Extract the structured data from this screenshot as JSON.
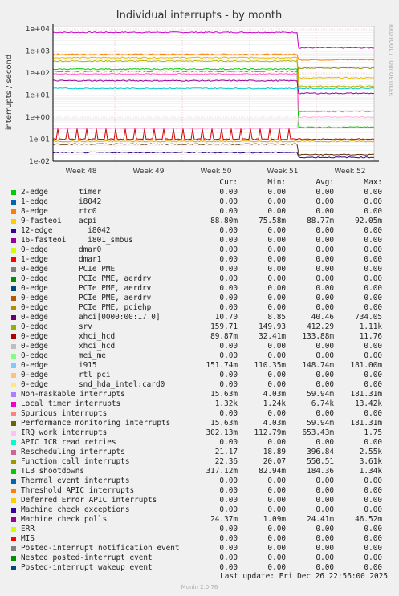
{
  "chart_data": {
    "type": "line",
    "title": "Individual interrupts - by month",
    "ylabel": "interrupts / second",
    "side_label": "RRDTOOL / TOBI OETIKER",
    "y_scale": "log",
    "ylim": [
      0.01,
      10000
    ],
    "y_ticks": [
      "1e-02",
      "1e-01",
      "1e+00",
      "1e+01",
      "1e+02",
      "1e+03",
      "1e+04"
    ],
    "x_ticks": [
      "Week 48",
      "Week 49",
      "Week 50",
      "Week 51",
      "Week 52"
    ],
    "grid": true,
    "series_approx": [
      {
        "color": "#cc00cc",
        "before": 7000,
        "after": 1400
      },
      {
        "color": "#ff8000",
        "before": 700,
        "after": 400
      },
      {
        "color": "#e6b800",
        "before": 500,
        "after": 60
      },
      {
        "color": "#b3b300",
        "before": 350,
        "after": 25
      },
      {
        "color": "#00cc00",
        "before": 150,
        "after": 0.35
      },
      {
        "color": "#888800",
        "before": 120,
        "after": 170
      },
      {
        "color": "#ff66cc",
        "before": 90,
        "after": 1.8
      },
      {
        "color": "#990099",
        "before": 45,
        "after": 12
      },
      {
        "color": "#00cccc",
        "before": 20,
        "after": 20
      },
      {
        "color": "#ffb3e6",
        "before": 0.3,
        "after": 1.0
      },
      {
        "color": "#cc0000",
        "before": 0.1,
        "after": 0.1
      },
      {
        "color": "#e6a800",
        "before": 0.08,
        "after": 0.08
      },
      {
        "color": "#5c2e00",
        "before": 0.06,
        "after": 0.02
      },
      {
        "color": "#2a0080",
        "before": 0.025,
        "after": 0.015
      }
    ]
  },
  "legend": {
    "headers": {
      "cur": "Cur:",
      "min": "Min:",
      "avg": "Avg:",
      "max": "Max:"
    },
    "rows": [
      {
        "color": "#00cc00",
        "name": "2-edge",
        "dev": "timer",
        "cur": "0.00",
        "min": "0.00",
        "avg": "0.00",
        "max": "0.00"
      },
      {
        "color": "#0066b3",
        "name": "1-edge",
        "dev": "i8042",
        "cur": "0.00",
        "min": "0.00",
        "avg": "0.00",
        "max": "0.00"
      },
      {
        "color": "#ff8000",
        "name": "8-edge",
        "dev": "rtc0",
        "cur": "0.00",
        "min": "0.00",
        "avg": "0.00",
        "max": "0.00"
      },
      {
        "color": "#ffcc00",
        "name": "9-fasteoi",
        "dev": "acpi",
        "cur": "88.80m",
        "min": "75.58m",
        "avg": "88.77m",
        "max": "92.05m"
      },
      {
        "color": "#330099",
        "name": "12-edge",
        "dev": "  i8042",
        "cur": "0.00",
        "min": "0.00",
        "avg": "0.00",
        "max": "0.00"
      },
      {
        "color": "#990099",
        "name": "16-fasteoi",
        "dev": "  i801_smbus",
        "cur": "0.00",
        "min": "0.00",
        "avg": "0.00",
        "max": "0.00"
      },
      {
        "color": "#ccff00",
        "name": "0-edge",
        "dev": "dmar0",
        "cur": "0.00",
        "min": "0.00",
        "avg": "0.00",
        "max": "0.00"
      },
      {
        "color": "#ff0000",
        "name": "1-edge",
        "dev": "dmar1",
        "cur": "0.00",
        "min": "0.00",
        "avg": "0.00",
        "max": "0.00"
      },
      {
        "color": "#808080",
        "name": "0-edge",
        "dev": "PCIe PME",
        "cur": "0.00",
        "min": "0.00",
        "avg": "0.00",
        "max": "0.00"
      },
      {
        "color": "#008f00",
        "name": "0-edge",
        "dev": "PCIe PME, aerdrv",
        "cur": "0.00",
        "min": "0.00",
        "avg": "0.00",
        "max": "0.00"
      },
      {
        "color": "#00487d",
        "name": "0-edge",
        "dev": "PCIe PME, aerdrv",
        "cur": "0.00",
        "min": "0.00",
        "avg": "0.00",
        "max": "0.00"
      },
      {
        "color": "#b35a00",
        "name": "0-edge",
        "dev": "PCIe PME, aerdrv",
        "cur": "0.00",
        "min": "0.00",
        "avg": "0.00",
        "max": "0.00"
      },
      {
        "color": "#b38f00",
        "name": "0-edge",
        "dev": "PCIe PME, pciehp",
        "cur": "0.00",
        "min": "0.00",
        "avg": "0.00",
        "max": "0.00"
      },
      {
        "color": "#6b006b",
        "name": "0-edge",
        "dev": "ahci[0000:00:17.0]",
        "cur": "10.70",
        "min": "8.85",
        "avg": "40.46",
        "max": "734.05"
      },
      {
        "color": "#8fb300",
        "name": "0-edge",
        "dev": "srv",
        "cur": "159.71",
        "min": "149.93",
        "avg": "412.29",
        "max": "1.11k"
      },
      {
        "color": "#b30000",
        "name": "0-edge",
        "dev": "xhci_hcd",
        "cur": "89.87m",
        "min": "32.41m",
        "avg": "133.88m",
        "max": "11.76"
      },
      {
        "color": "#bebebe",
        "name": "0-edge",
        "dev": "xhci_hcd",
        "cur": "0.00",
        "min": "0.00",
        "avg": "0.00",
        "max": "0.00"
      },
      {
        "color": "#80ff80",
        "name": "0-edge",
        "dev": "mei_me",
        "cur": "0.00",
        "min": "0.00",
        "avg": "0.00",
        "max": "0.00"
      },
      {
        "color": "#80c9ff",
        "name": "0-edge",
        "dev": "i915",
        "cur": "151.74m",
        "min": "110.35m",
        "avg": "148.74m",
        "max": "181.00m"
      },
      {
        "color": "#ffc080",
        "name": "0-edge",
        "dev": "rtl_pci",
        "cur": "0.00",
        "min": "0.00",
        "avg": "0.00",
        "max": "0.00"
      },
      {
        "color": "#ffe680",
        "name": "0-edge",
        "dev": "snd_hda_intel:card0",
        "cur": "0.00",
        "min": "0.00",
        "avg": "0.00",
        "max": "0.00"
      },
      {
        "color": "#aa80ff",
        "name": "Non-maskable interrupts",
        "dev": "",
        "cur": "15.63m",
        "min": "4.03m",
        "avg": "59.94m",
        "max": "181.31m"
      },
      {
        "color": "#ee00cc",
        "name": "Local timer interrupts",
        "dev": "",
        "cur": "1.32k",
        "min": "1.24k",
        "avg": "6.74k",
        "max": "13.42k"
      },
      {
        "color": "#ff8080",
        "name": "Spurious interrupts",
        "dev": "",
        "cur": "0.00",
        "min": "0.00",
        "avg": "0.00",
        "max": "0.00"
      },
      {
        "color": "#666600",
        "name": "Performance monitoring interrupts",
        "dev": "",
        "cur": "15.63m",
        "min": "4.03m",
        "avg": "59.94m",
        "max": "181.31m"
      },
      {
        "color": "#ffbfff",
        "name": "IRQ work interrupts",
        "dev": "",
        "cur": "302.13m",
        "min": "112.79m",
        "avg": "653.43m",
        "max": "1.75"
      },
      {
        "color": "#00ffcc",
        "name": "APIC ICR read retries",
        "dev": "",
        "cur": "0.00",
        "min": "0.00",
        "avg": "0.00",
        "max": "0.00"
      },
      {
        "color": "#cc6699",
        "name": "Rescheduling interrupts",
        "dev": "",
        "cur": "21.17",
        "min": "18.89",
        "avg": "396.84",
        "max": "2.55k"
      },
      {
        "color": "#999900",
        "name": "Function call interrupts",
        "dev": "",
        "cur": "22.36",
        "min": "20.07",
        "avg": "550.51",
        "max": "3.61k"
      },
      {
        "color": "#00cc00",
        "name": "TLB shootdowns",
        "dev": "",
        "cur": "317.12m",
        "min": "82.94m",
        "avg": "184.36",
        "max": "1.34k"
      },
      {
        "color": "#0066b3",
        "name": "Thermal event interrupts",
        "dev": "",
        "cur": "0.00",
        "min": "0.00",
        "avg": "0.00",
        "max": "0.00"
      },
      {
        "color": "#ff8000",
        "name": "Threshold APIC interrupts",
        "dev": "",
        "cur": "0.00",
        "min": "0.00",
        "avg": "0.00",
        "max": "0.00"
      },
      {
        "color": "#ffcc00",
        "name": "Deferred Error APIC interrupts",
        "dev": "",
        "cur": "0.00",
        "min": "0.00",
        "avg": "0.00",
        "max": "0.00"
      },
      {
        "color": "#330099",
        "name": "Machine check exceptions",
        "dev": "",
        "cur": "0.00",
        "min": "0.00",
        "avg": "0.00",
        "max": "0.00"
      },
      {
        "color": "#990099",
        "name": "Machine check polls",
        "dev": "",
        "cur": "24.37m",
        "min": "1.09m",
        "avg": "24.41m",
        "max": "46.52m"
      },
      {
        "color": "#ccff00",
        "name": "ERR",
        "dev": "",
        "cur": "0.00",
        "min": "0.00",
        "avg": "0.00",
        "max": "0.00"
      },
      {
        "color": "#ff0000",
        "name": "MIS",
        "dev": "",
        "cur": "0.00",
        "min": "0.00",
        "avg": "0.00",
        "max": "0.00"
      },
      {
        "color": "#808080",
        "name": "Posted-interrupt notification event",
        "dev": "",
        "cur": "0.00",
        "min": "0.00",
        "avg": "0.00",
        "max": "0.00"
      },
      {
        "color": "#008f00",
        "name": "Nested posted-interrupt event",
        "dev": "",
        "cur": "0.00",
        "min": "0.00",
        "avg": "0.00",
        "max": "0.00"
      },
      {
        "color": "#00487d",
        "name": "Posted-interrupt wakeup event",
        "dev": "",
        "cur": "0.00",
        "min": "0.00",
        "avg": "0.00",
        "max": "0.00"
      }
    ]
  },
  "footer": {
    "last_update": "Last update: Fri Dec 26 22:56:00 2025",
    "munin": "Munin 2.0.76"
  }
}
